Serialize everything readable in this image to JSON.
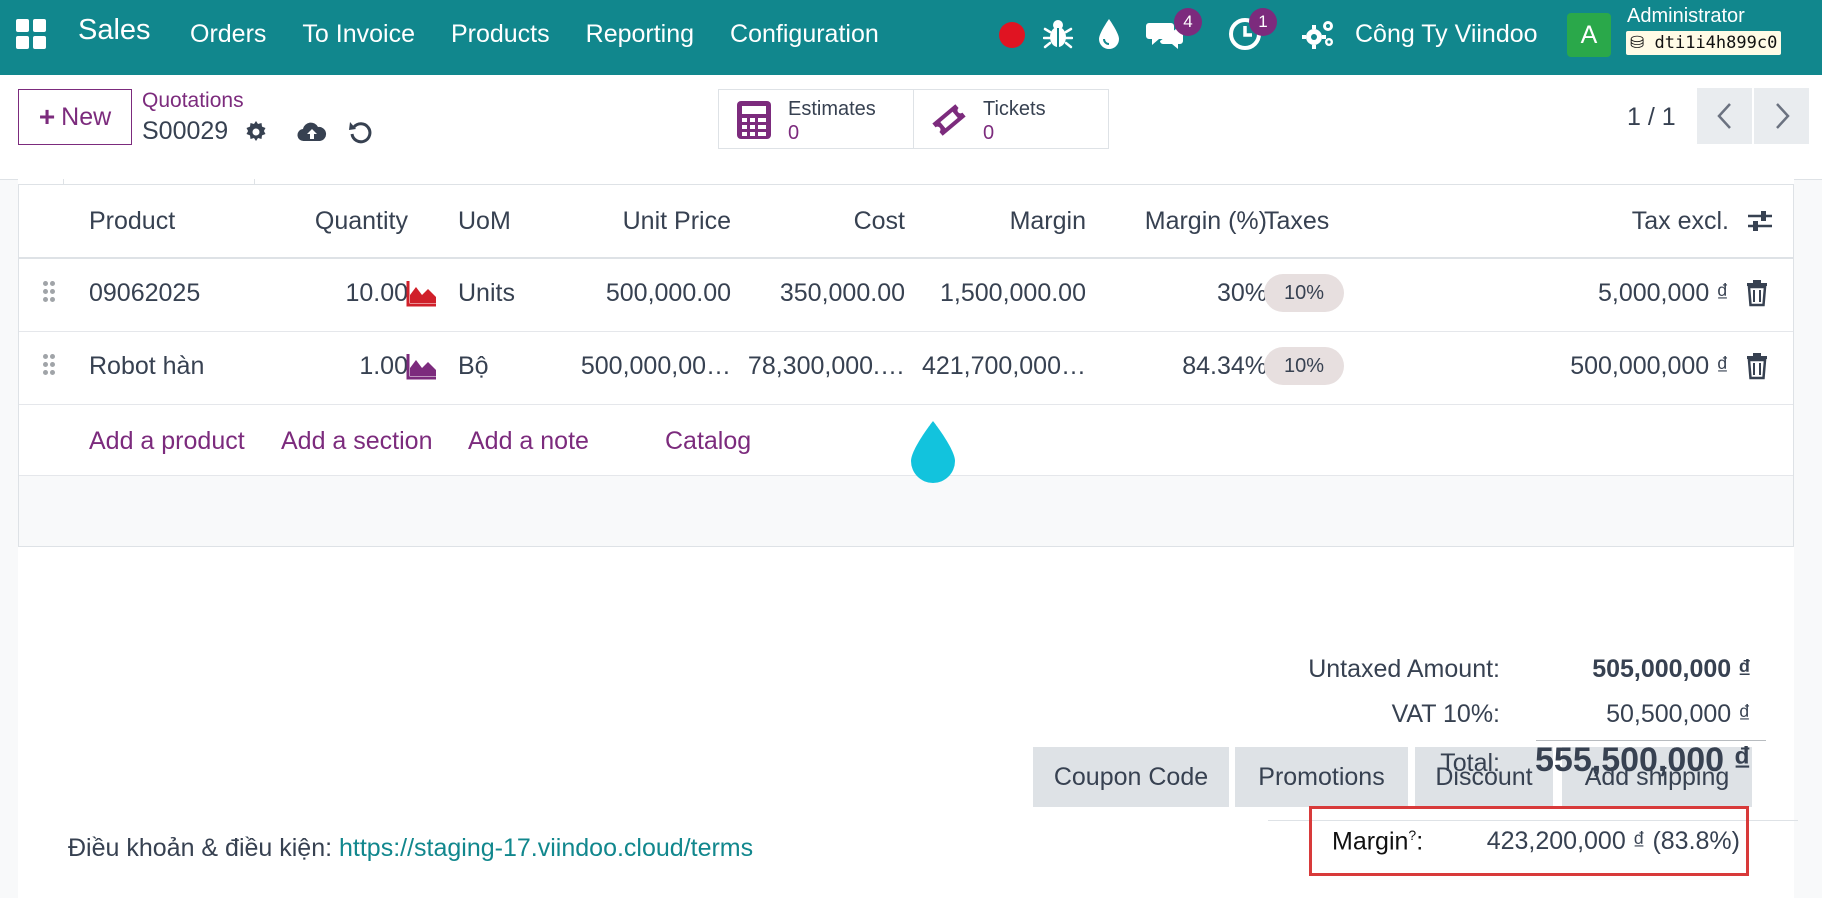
{
  "nav": {
    "app_name": "Sales",
    "menu": [
      "Orders",
      "To Invoice",
      "Products",
      "Reporting",
      "Configuration"
    ],
    "chat_badge": "4",
    "activity_badge": "1",
    "company": "Công Ty Viindoo",
    "avatar_letter": "A",
    "user": "Administrator",
    "db_name": "dti1i4h899c0"
  },
  "control": {
    "new_label": "New",
    "breadcrumb": "Quotations",
    "record": "S00029",
    "smart_buttons": [
      {
        "label": "Estimates",
        "value": "0"
      },
      {
        "label": "Tickets",
        "value": "0"
      }
    ],
    "pager": "1 / 1"
  },
  "table": {
    "headers": {
      "product": "Product",
      "quantity": "Quantity",
      "uom": "UoM",
      "unit_price": "Unit Price",
      "cost": "Cost",
      "margin": "Margin",
      "margin_pct": "Margin (%)",
      "taxes": "Taxes",
      "tax_excl": "Tax excl."
    },
    "rows": [
      {
        "product": "09062025",
        "quantity": "10.00",
        "uom": "Units",
        "unit_price": "500,000.00",
        "cost": "350,000.00",
        "margin": "1,500,000.00",
        "margin_pct": "30%",
        "tax": "10%",
        "subtotal": "5,000,000 ₫",
        "graph_color": "#d0202a"
      },
      {
        "product": "Robot hàn",
        "quantity": "1.00",
        "uom": "Bộ",
        "unit_price": "500,000,00…",
        "cost": "78,300,000.…",
        "margin": "421,700,000…",
        "margin_pct": "84.34%",
        "tax": "10%",
        "subtotal": "500,000,000 ₫",
        "graph_color": "#7c2b7d"
      }
    ],
    "add_links": {
      "product": "Add a product",
      "section": "Add a section",
      "note": "Add a note",
      "catalog": "Catalog"
    }
  },
  "actions": {
    "coupon": "Coupon Code",
    "promotions": "Promotions",
    "discount": "Discount",
    "shipping": "Add shipping"
  },
  "terms": {
    "label": "Điều khoản & điều kiện: ",
    "url": "https://staging-17.viindoo.cloud/terms"
  },
  "totals": {
    "untaxed_label": "Untaxed Amount:",
    "untaxed_value": "505,000,000 ₫",
    "vat_label": "VAT 10%:",
    "vat_value": "50,500,000 ₫",
    "total_label": "Total:",
    "total_value": "555,500,000 ₫",
    "margin_label": "Margin",
    "margin_help": "?",
    "margin_value": "423,200,000 ₫ (83.8%)"
  },
  "colors": {
    "brand": "#11878d",
    "primary": "#7c2b7d",
    "highlight_border": "#d83a3a"
  }
}
